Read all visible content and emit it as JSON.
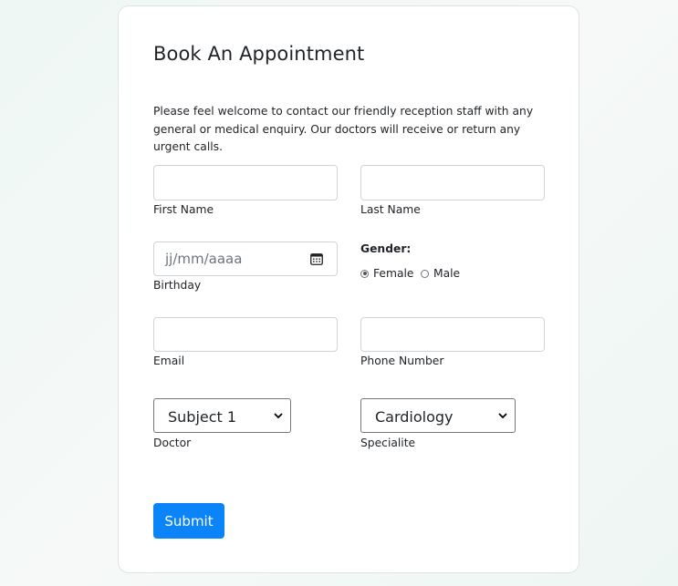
{
  "form": {
    "title": "Book An Appointment",
    "intro": "Please feel welcome to contact our friendly reception staff with any general or medical enquiry. Our doctors will receive or return any urgent calls.",
    "first_name": {
      "value": "",
      "label": "First Name"
    },
    "last_name": {
      "value": "",
      "label": "Last Name"
    },
    "birthday": {
      "placeholder": "jj/mm/aaaa",
      "label": "Birthday"
    },
    "gender": {
      "label": "Gender:",
      "options": [
        {
          "label": "Female",
          "checked": true
        },
        {
          "label": "Male",
          "checked": false
        }
      ]
    },
    "email": {
      "value": "",
      "label": "Email"
    },
    "phone": {
      "value": "",
      "label": "Phone Number"
    },
    "doctor": {
      "selected": "Subject 1",
      "label": "Doctor"
    },
    "speciality": {
      "selected": "Cardiology",
      "label": "Specialite"
    },
    "submit_label": "Submit"
  },
  "icons": {
    "calendar": "calendar-icon",
    "chevron": "chevron-down-icon"
  },
  "colors": {
    "submit_bg": "#0b84f9",
    "input_border": "#ced4da",
    "card_bg": "#ffffff"
  }
}
